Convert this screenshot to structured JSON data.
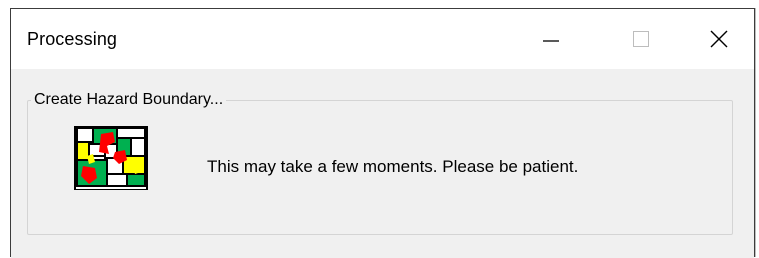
{
  "window": {
    "title": "Processing",
    "minimize_icon": "minimize-icon",
    "maximize_icon": "maximize-icon",
    "close_icon": "close-icon"
  },
  "group": {
    "label": "Create Hazard Boundary..."
  },
  "icon": {
    "name": "hazard-map-icon",
    "colors": [
      "#00b050",
      "#ff0000",
      "#ffff00",
      "#000000",
      "#ffffff"
    ]
  },
  "message": {
    "text": "This may take a few moments. Please be patient."
  }
}
